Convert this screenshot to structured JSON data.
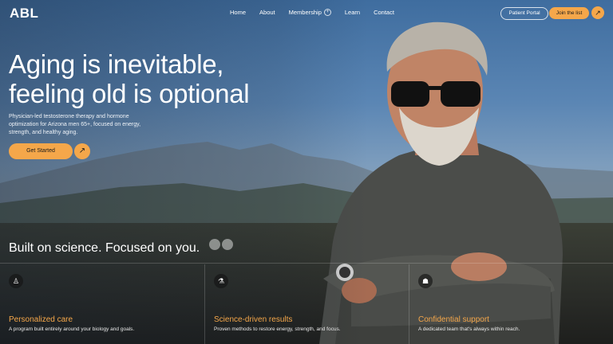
{
  "brand": {
    "logo": "ABL"
  },
  "nav": {
    "items": [
      "Home",
      "About",
      "Membership",
      "Learn",
      "Contact"
    ],
    "membership_plus": "+"
  },
  "header": {
    "portal_label": "Patient Portal",
    "join_label": "Join the list",
    "join_arrow": "↗"
  },
  "hero": {
    "title_line1": "Aging is inevitable,",
    "title_line2": "feeling old is optional",
    "subtitle": "Physician-led testosterone therapy and hormone optimization for Arizona men 65+, focused on energy, strength, and healthy aging.",
    "cta_label": "Get Started",
    "cta_arrow": "↗"
  },
  "tagline": "Built on science.  Focused on you.",
  "features": [
    {
      "icon": "person-icon",
      "glyph": "♙",
      "title": "Personalized care",
      "desc": "A program built entirely around your biology and goals."
    },
    {
      "icon": "microscope-icon",
      "glyph": "⚗",
      "title": "Science-driven results",
      "desc": "Proven methods to restore energy, strength, and focus."
    },
    {
      "icon": "handshake-icon",
      "glyph": "☗",
      "title": "Confidential support",
      "desc": "A dedicated team that's always within reach."
    }
  ],
  "colors": {
    "accent": "#f5a74a",
    "sky": "#3f6d9f"
  }
}
